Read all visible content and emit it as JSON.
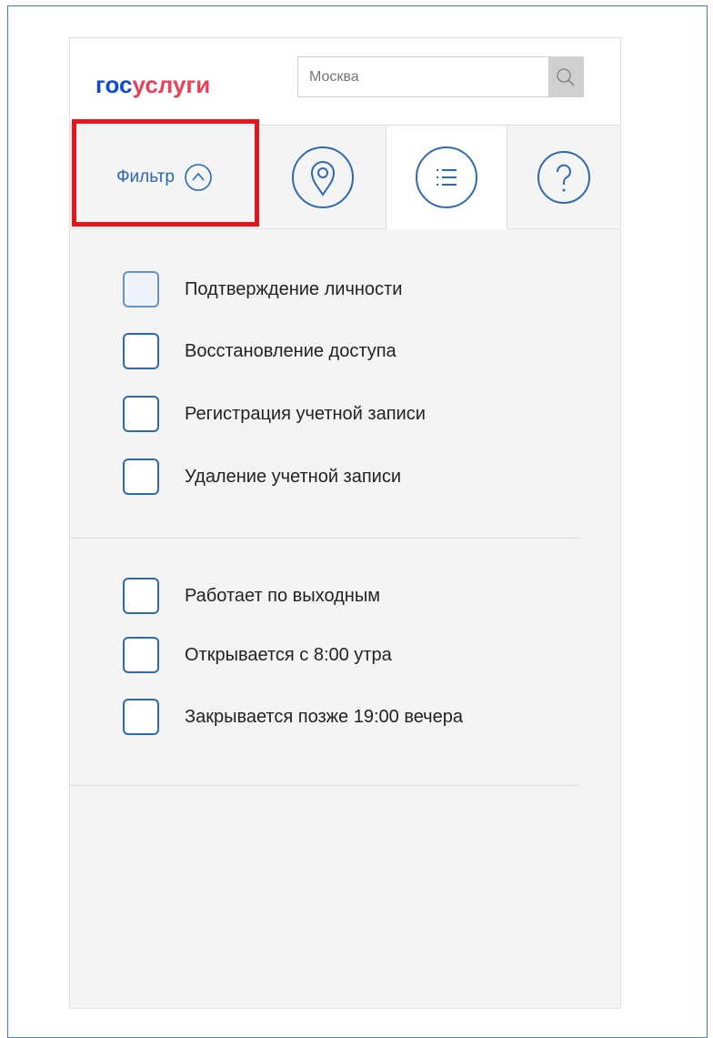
{
  "header": {
    "logo": {
      "part1": "гос",
      "part2": "услуги",
      "part3": ""
    },
    "search": {
      "placeholder": "Москва",
      "value": ""
    }
  },
  "tabs": {
    "filter_label": "Фильтр",
    "items": [
      {
        "name": "map",
        "icon": "map-pin-icon"
      },
      {
        "name": "list",
        "icon": "list-icon",
        "active": true
      },
      {
        "name": "help",
        "icon": "question-icon"
      }
    ]
  },
  "filters": {
    "services": [
      {
        "label": "Подтверждение личности",
        "checked": false
      },
      {
        "label": "Восстановление доступа",
        "checked": false
      },
      {
        "label": "Регистрация учетной записи",
        "checked": false
      },
      {
        "label": "Удаление учетной записи",
        "checked": false
      }
    ],
    "schedule": [
      {
        "label": "Работает по выходным",
        "checked": false
      },
      {
        "label": "Открывается с 8:00 утра",
        "checked": false
      },
      {
        "label": "Закрывается позже 19:00 вечера",
        "checked": false
      }
    ]
  },
  "colors": {
    "accent": "#2e6ab3",
    "logo_blue": "#0d4cd3",
    "logo_red": "#ee3f58",
    "highlight_red": "#e8141c"
  }
}
